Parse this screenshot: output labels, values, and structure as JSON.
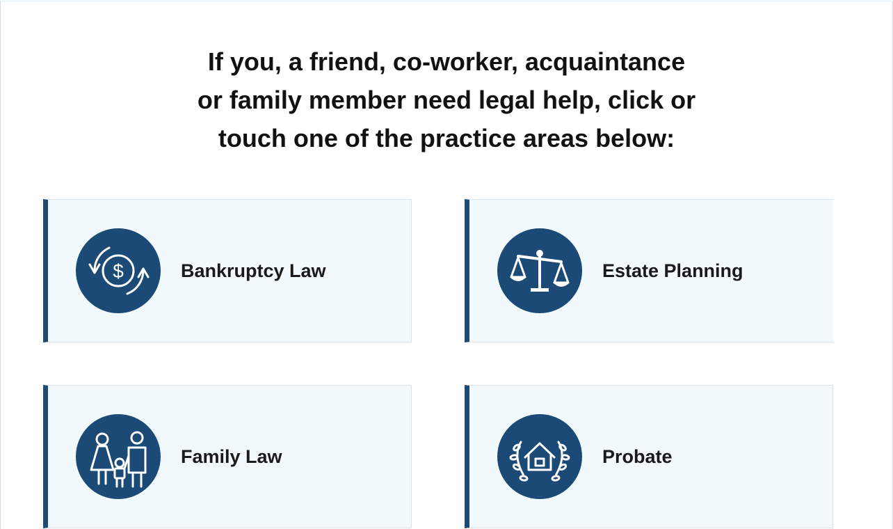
{
  "headline": {
    "line1": "If you, a friend, co-worker, acquaintance",
    "line2": "or family member need legal help, click or",
    "line3": "touch one of the practice areas below:"
  },
  "practice_areas": [
    {
      "label": "Bankruptcy Law",
      "icon": "dollar-cycle-icon"
    },
    {
      "label": "Estate Planning",
      "icon": "scales-of-justice-icon"
    },
    {
      "label": "Family Law",
      "icon": "family-icon"
    },
    {
      "label": "Probate",
      "icon": "house-laurel-icon"
    }
  ],
  "colors": {
    "accent": "#1c4a76",
    "card_bg": "#f2f9fc",
    "text": "#111111"
  }
}
